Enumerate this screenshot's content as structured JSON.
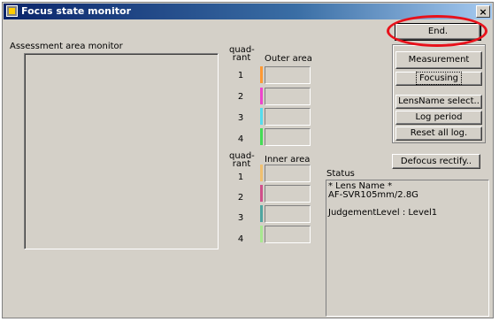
{
  "window": {
    "title": "Focus state monitor",
    "close_glyph": "×"
  },
  "assessment": {
    "label": "Assessment area monitor"
  },
  "outer": {
    "quad_label_1": "quad-",
    "quad_label_2": "rant",
    "header": "Outer area",
    "rows": [
      {
        "num": "1",
        "color": "#ff9933"
      },
      {
        "num": "2",
        "color": "#ee44cc"
      },
      {
        "num": "3",
        "color": "#55ddee"
      },
      {
        "num": "4",
        "color": "#44dd55"
      }
    ]
  },
  "inner": {
    "quad_label_1": "quad-",
    "quad_label_2": "rant",
    "header": "Inner area",
    "rows": [
      {
        "num": "1",
        "color": "#f0c070"
      },
      {
        "num": "2",
        "color": "#d04f8a"
      },
      {
        "num": "3",
        "color": "#4fa6a0"
      },
      {
        "num": "4",
        "color": "#a8e890"
      }
    ]
  },
  "buttons": {
    "end": "End.",
    "measurement": "Measurement",
    "focusing": "Focusing",
    "lensname": "LensName select..",
    "logperiod": "Log period",
    "resetlog": "Reset all log.",
    "defocus": "Defocus rectify.."
  },
  "status": {
    "label": "Status",
    "line1": "* Lens Name *",
    "line2": "AF-SVR105mm/2.8G",
    "line3": "JudgementLevel : Level1"
  },
  "annotation": {
    "color": "#e8111a"
  }
}
